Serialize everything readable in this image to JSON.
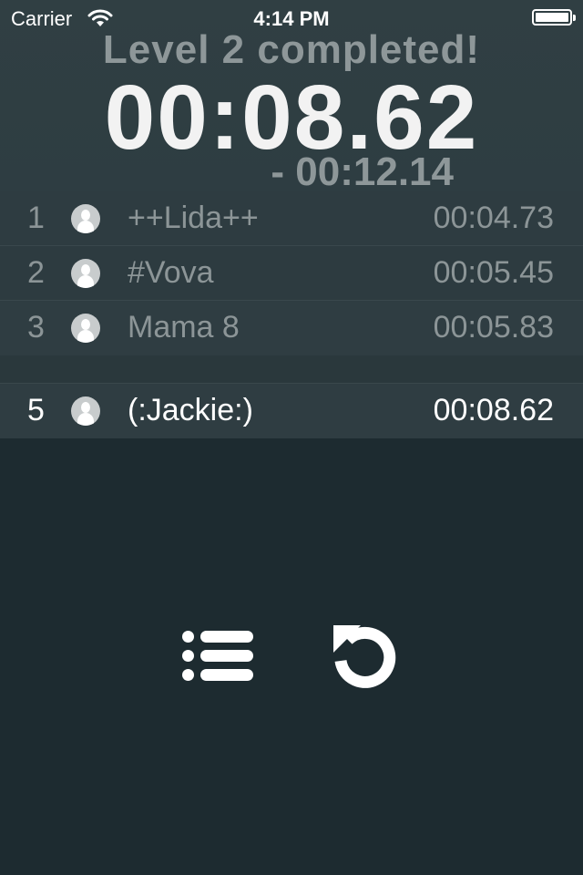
{
  "status_bar": {
    "carrier": "Carrier",
    "time": "4:14 PM",
    "battery_level": 1.0
  },
  "result": {
    "title": "Level 2 completed!",
    "time": "00:08.62",
    "difference": "- 00:12.14"
  },
  "leaderboard": {
    "top": [
      {
        "rank": "1",
        "name": "++Lida++",
        "time": "00:04.73"
      },
      {
        "rank": "2",
        "name": "#Vova",
        "time": "00:05.45"
      },
      {
        "rank": "3",
        "name": "Mama 8",
        "time": "00:05.83"
      }
    ],
    "current": {
      "rank": "5",
      "name": "(:Jackie:)",
      "time": "00:08.62"
    }
  },
  "icons": {
    "list": "list-icon",
    "replay": "replay-icon",
    "avatar": "user-avatar-icon",
    "wifi": "wifi-icon",
    "battery": "battery-icon"
  },
  "colors": {
    "background": "#1d2b30",
    "header": "#2e3d42",
    "muted_text": "#8c9597",
    "highlight_text": "#ffffff"
  }
}
